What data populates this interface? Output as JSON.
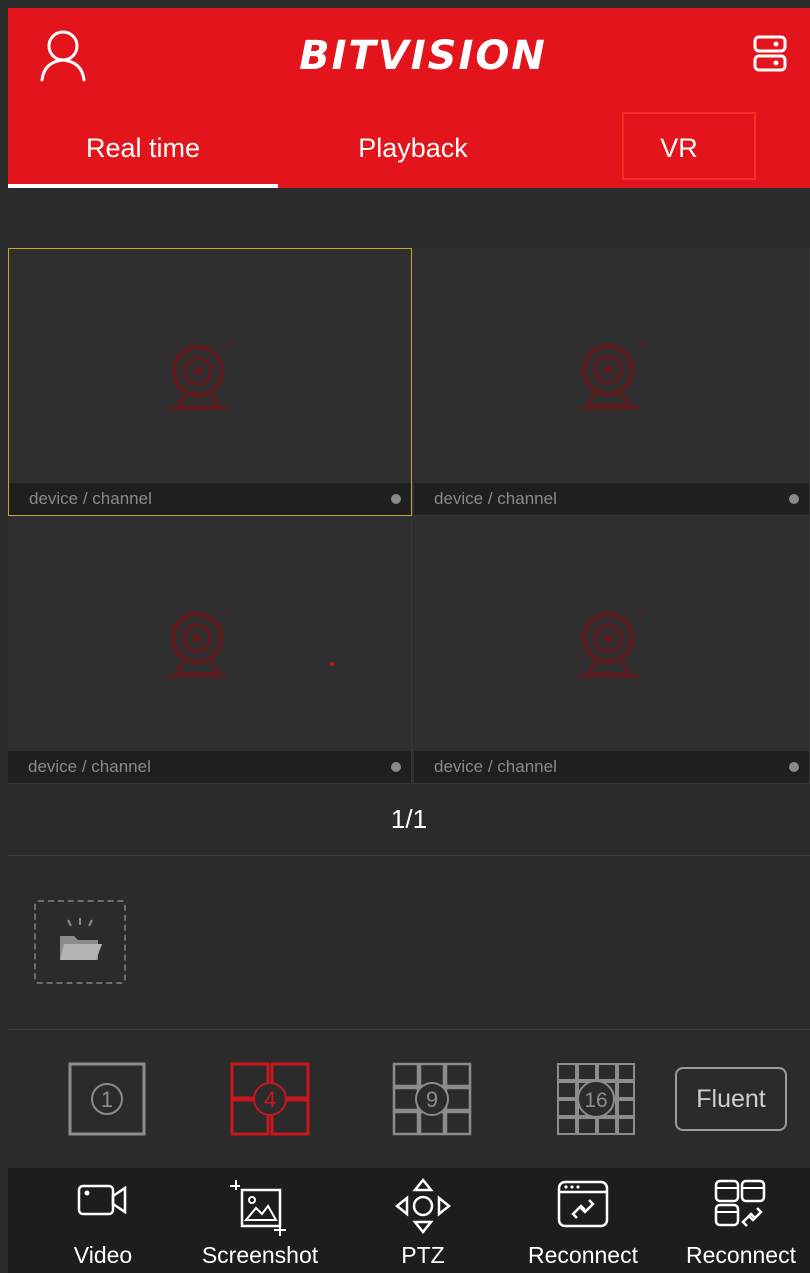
{
  "header": {
    "brand": "BITVISION",
    "background_color": "#e3141b",
    "user_icon": "user-icon",
    "device_icon": "device-list-icon"
  },
  "tabs": [
    {
      "label": "Real time",
      "active": true
    },
    {
      "label": "Playback",
      "active": false
    },
    {
      "label": "VR",
      "active": false,
      "highlighted": true
    }
  ],
  "grid": {
    "cells": [
      {
        "label": "device / channel",
        "selected": true
      },
      {
        "label": "device / channel",
        "selected": false
      },
      {
        "label": "device / channel",
        "selected": false
      },
      {
        "label": "device / channel",
        "selected": false
      }
    ],
    "placeholder_icon": "camera-icon",
    "selected_border_color": "#c8a62a"
  },
  "pager": {
    "text": "1/1"
  },
  "folder": {
    "icon": "folder-icon"
  },
  "layouts": [
    {
      "label": "1",
      "active": false
    },
    {
      "label": "4",
      "active": true
    },
    {
      "label": "9",
      "active": false
    },
    {
      "label": "16",
      "active": false
    }
  ],
  "stream_quality": "Fluent",
  "toolbar": [
    {
      "label": "Video",
      "icon": "video-camera-icon"
    },
    {
      "label": "Screenshot",
      "icon": "screenshot-icon"
    },
    {
      "label": "PTZ",
      "icon": "ptz-icon"
    },
    {
      "label": "Reconnect",
      "icon": "reconnect-icon"
    },
    {
      "label": "Reconnect",
      "icon": "reconnect-all-icon"
    }
  ]
}
